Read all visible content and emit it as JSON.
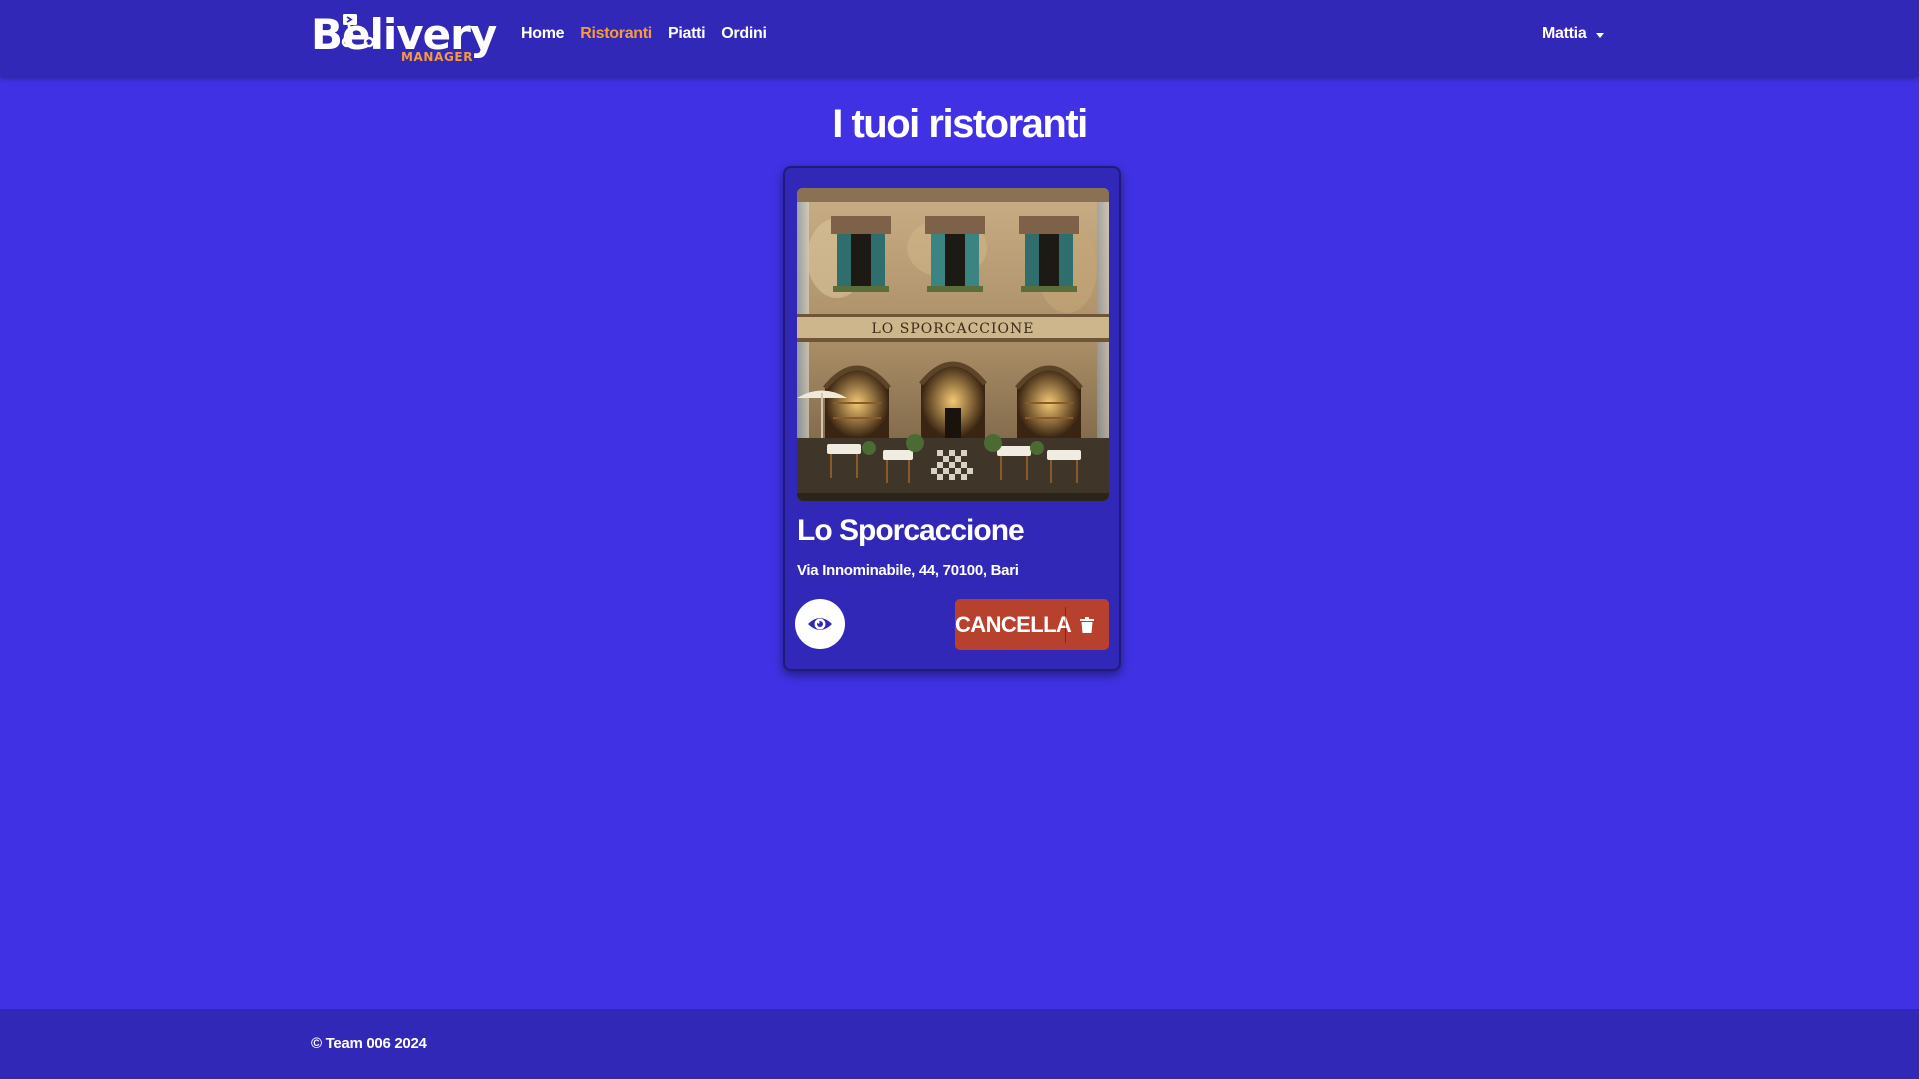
{
  "brand": {
    "name": "Belivery",
    "subtitle": "MANAGER",
    "accent_color": "#f59b3d"
  },
  "nav": {
    "links": [
      {
        "label": "Home",
        "active": false
      },
      {
        "label": "Ristoranti",
        "active": true
      },
      {
        "label": "Piatti",
        "active": false
      },
      {
        "label": "Ordini",
        "active": false
      }
    ],
    "user": {
      "name": "Mattia"
    }
  },
  "main": {
    "title": "I tuoi ristoranti",
    "restaurants": [
      {
        "name": "Lo Sporcaccione",
        "address": "Via Innominabile, 44, 70100, Bari",
        "sign_text": "LO SPORCACCIONE",
        "view_icon": "eye-icon",
        "delete_label": "CANCELLA",
        "delete_icon": "trash-icon"
      }
    ]
  },
  "footer": {
    "text": "© Team 006 2024"
  },
  "colors": {
    "background": "#4032e4",
    "navbar": "#3128b8",
    "card": "#3128b8",
    "danger": "#b8412e"
  }
}
